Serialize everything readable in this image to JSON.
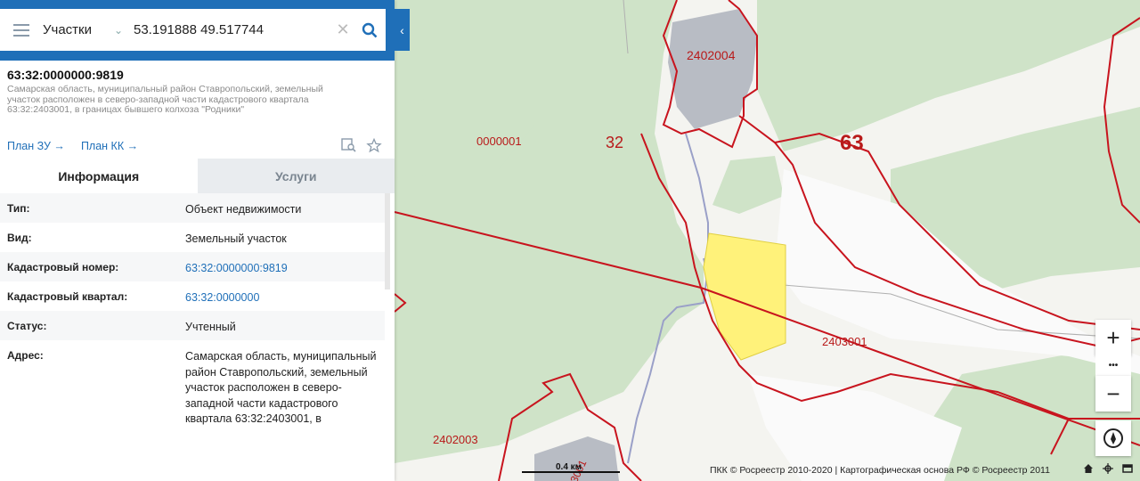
{
  "search": {
    "layer": "Участки",
    "query": "53.191888 49.517744"
  },
  "object": {
    "cadastral_id": "63:32:0000000:9819",
    "description": "Самарская область, муниципальный район Ставропольский, земельный участок расположен в северо-западной части кадастрового квартала 63:32:2403001, в границах бывшего колхоза \"Родники\"",
    "plan_zu": "План ЗУ →",
    "plan_kk": "План КК →"
  },
  "tabs": {
    "info": "Информация",
    "services": "Услуги"
  },
  "info_rows": [
    {
      "key": "Тип:",
      "value": "Объект недвижимости"
    },
    {
      "key": "Вид:",
      "value": "Земельный участок"
    },
    {
      "key": "Кадастровый номер:",
      "value": "63:32:0000000:9819"
    },
    {
      "key": "Кадастровый квартал:",
      "value": "63:32:0000000"
    },
    {
      "key": "Статус:",
      "value": "Учтенный"
    },
    {
      "key": "Адрес:",
      "value": "Самарская область, муниципальный район Ставропольский, земельный участок расположен в северо-западной части кадастрового квартала 63:32:2403001, в"
    }
  ],
  "map_labels": {
    "q2402004": "2402004",
    "q0000001": "0000001",
    "district": "32",
    "region": "63",
    "q2403001": "2403001",
    "q2402003": "2402003",
    "q2403001b": "2403001"
  },
  "scale_label": "0.4 км",
  "attribution": "ПКК © Росреестр 2010-2020 | Картографическая основа РФ © Росреестр 2011",
  "controls": {
    "zoom_in": "+",
    "more": "•••",
    "zoom_out": "−"
  },
  "colors": {
    "accent": "#1f6fb8",
    "boundary": "#c8141e",
    "parcel": "#fff27a",
    "forest": "#cfe3c8"
  }
}
